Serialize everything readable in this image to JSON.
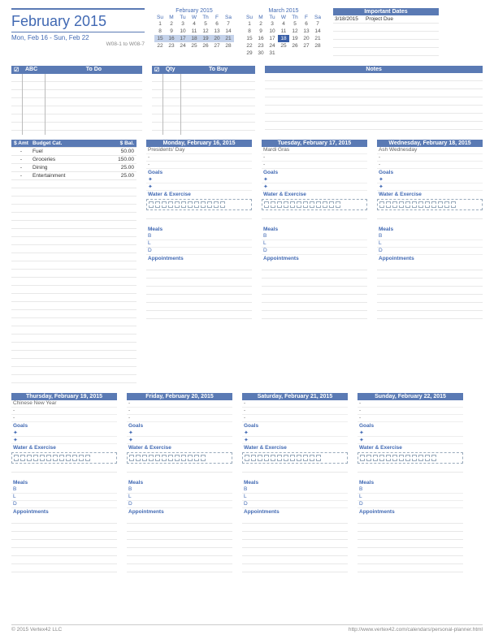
{
  "title": "February 2015",
  "range": "Mon, Feb 16  -  Sun, Feb 22",
  "weeks": "W08-1 to W08-7",
  "cal1": {
    "title": "February 2015",
    "dow": [
      "Su",
      "M",
      "Tu",
      "W",
      "Th",
      "F",
      "Sa"
    ],
    "rows": [
      [
        "1",
        "2",
        "3",
        "4",
        "5",
        "6",
        "7"
      ],
      [
        "8",
        "9",
        "10",
        "11",
        "12",
        "13",
        "14"
      ],
      [
        "15",
        "16",
        "17",
        "18",
        "19",
        "20",
        "21"
      ],
      [
        "22",
        "23",
        "24",
        "25",
        "26",
        "27",
        "28"
      ],
      [
        "",
        "",
        "",
        "",
        "",
        "",
        ""
      ]
    ],
    "hl_row": 2
  },
  "cal2": {
    "title": "March 2015",
    "dow": [
      "Su",
      "M",
      "Tu",
      "W",
      "Th",
      "F",
      "Sa"
    ],
    "rows": [
      [
        "1",
        "2",
        "3",
        "4",
        "5",
        "6",
        "7"
      ],
      [
        "8",
        "9",
        "10",
        "11",
        "12",
        "13",
        "14"
      ],
      [
        "15",
        "16",
        "17",
        "18",
        "19",
        "20",
        "21"
      ],
      [
        "22",
        "23",
        "24",
        "25",
        "26",
        "27",
        "28"
      ],
      [
        "29",
        "30",
        "31",
        "",
        "",
        "",
        ""
      ]
    ],
    "today": [
      2,
      3
    ]
  },
  "important": {
    "title": "Important Dates",
    "items": [
      {
        "d": "3/18/2015",
        "t": "Project Due"
      }
    ]
  },
  "todo": {
    "h1": "☑",
    "h2": "ABC",
    "h3": "To Do"
  },
  "tobuy": {
    "h1": "☑",
    "h2": "Qty",
    "h3": "To Buy"
  },
  "notes": {
    "title": "Notes"
  },
  "budget": {
    "h1": "$ Amt",
    "h2": "Budget Cat.",
    "h3": "$ Bal.",
    "rows": [
      {
        "a": "-",
        "c": "Fuel",
        "b": "50.00"
      },
      {
        "a": "-",
        "c": "Groceries",
        "b": "150.00"
      },
      {
        "a": "-",
        "c": "Dining",
        "b": "25.00"
      },
      {
        "a": "-",
        "c": "Entertainment",
        "b": "25.00"
      }
    ]
  },
  "days": [
    {
      "title": "Monday, February 16, 2015",
      "note": "Presidents' Day"
    },
    {
      "title": "Tuesday, February 17, 2015",
      "note": "Mardi Gras"
    },
    {
      "title": "Wednesday, February 18, 2015",
      "note": "Ash Wednesday"
    },
    {
      "title": "Thursday, February 19, 2015",
      "note": "Chinese New Year"
    },
    {
      "title": "Friday, February 20, 2015",
      "note": "-"
    },
    {
      "title": "Saturday, February 21, 2015",
      "note": "-"
    },
    {
      "title": "Sunday, February 22, 2015",
      "note": "-"
    }
  ],
  "labels": {
    "goals": "Goals",
    "water": "Water & Exercise",
    "meals": "Meals",
    "b": "B",
    "l": "L",
    "d": "D",
    "appt": "Appointments"
  },
  "footer": {
    "l": "© 2015 Vertex42 LLC",
    "r": "http://www.vertex42.com/calendars/personal-planner.html"
  }
}
